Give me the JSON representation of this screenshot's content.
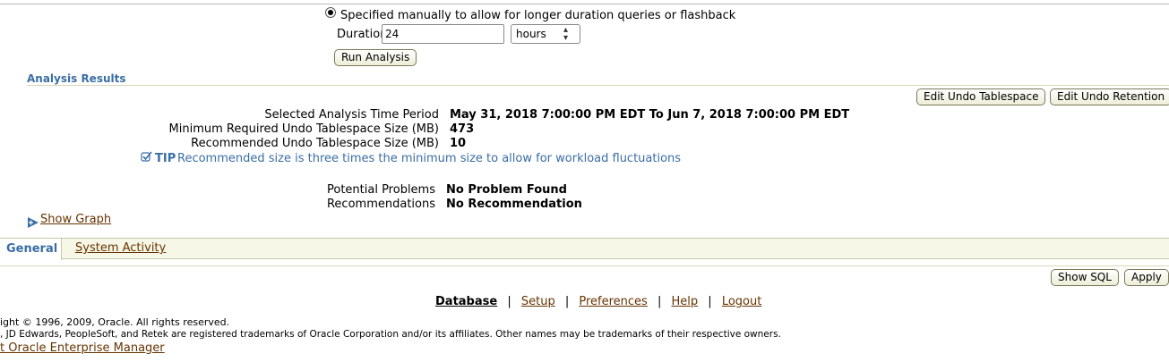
{
  "retention": {
    "manual_option_label": "Specified manually to allow for longer duration queries or flashback",
    "duration_label": "Duration",
    "duration_value": "24",
    "duration_unit": "hours",
    "run_button": "Run Analysis"
  },
  "analysis": {
    "heading": "Analysis Results",
    "edit_tablespace_button": "Edit Undo Tablespace",
    "edit_retention_button": "Edit Undo Retention",
    "rows": [
      {
        "label": "Selected Analysis Time Period",
        "value": "May 31, 2018 7:00:00 PM EDT To Jun 7, 2018 7:00:00 PM EDT"
      },
      {
        "label": "Minimum Required Undo Tablespace Size (MB)",
        "value": "473"
      },
      {
        "label": "Recommended Undo Tablespace Size (MB)",
        "value": "10"
      }
    ],
    "tip_label": "TIP",
    "tip_text": "Recommended size is three times the minimum size to allow for workload fluctuations",
    "problems_label": "Potential Problems",
    "problems_value": "No Problem Found",
    "recommendations_label": "Recommendations",
    "recommendations_value": "No Recommendation",
    "show_graph": "Show Graph"
  },
  "tabs": [
    {
      "label": "General",
      "active": true
    },
    {
      "label": "System Activity",
      "active": false
    }
  ],
  "actions": {
    "show_sql": "Show SQL",
    "apply": "Apply"
  },
  "footer": {
    "links": [
      "Database",
      "Setup",
      "Preferences",
      "Help",
      "Logout"
    ],
    "separator": "|",
    "copyright": "ight © 1996, 2009, Oracle. All rights reserved.",
    "trademark": ", JD Edwards, PeopleSoft, and Retek are registered trademarks of Oracle Corporation and/or its affiliates. Other names may be trademarks of their respective owners.",
    "about_link": "t Oracle Enterprise Manager"
  },
  "colors": {
    "section_heading": "#3a6ea5",
    "link": "#663300",
    "tab_bar": "#f7f7e7"
  }
}
